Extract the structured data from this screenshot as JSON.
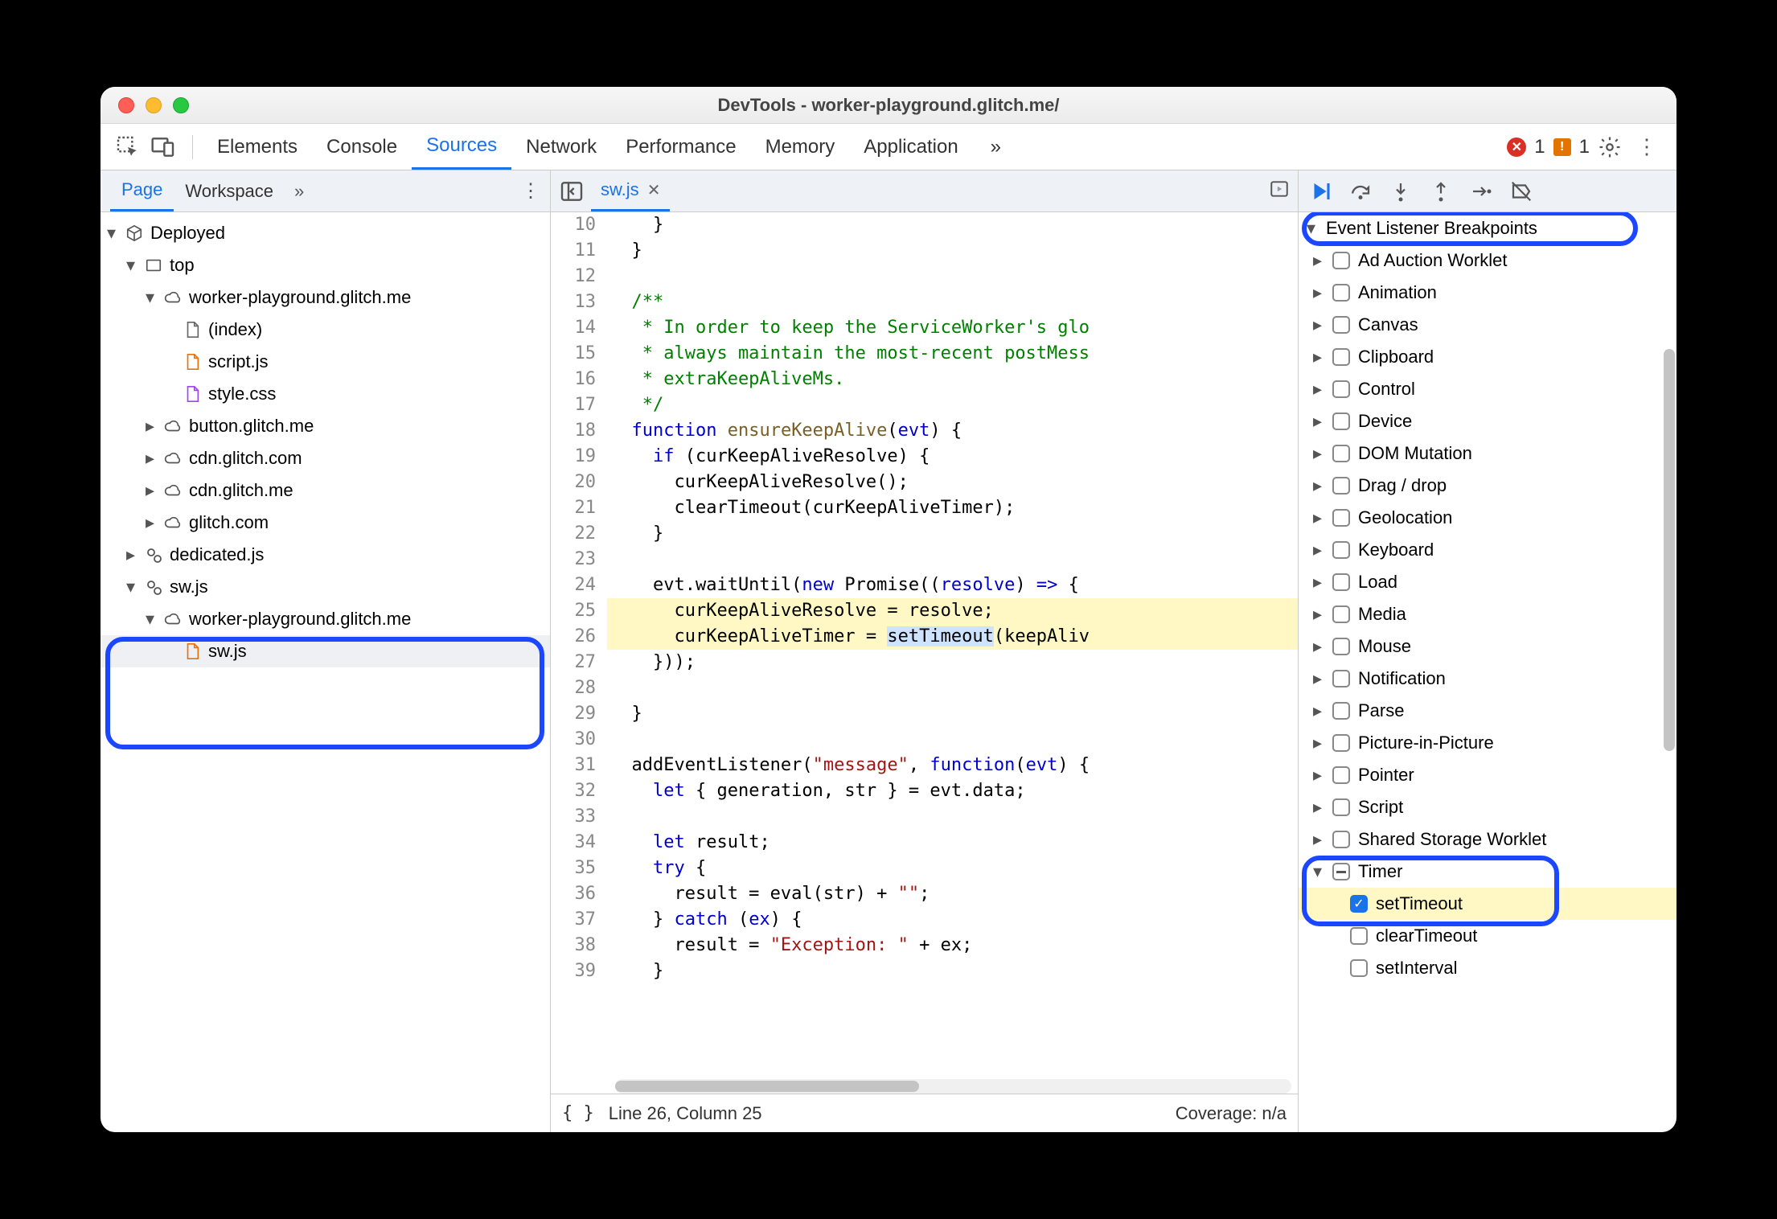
{
  "window": {
    "title": "DevTools - worker-playground.glitch.me/"
  },
  "toolbar": {
    "tabs": [
      "Elements",
      "Console",
      "Sources",
      "Network",
      "Performance",
      "Memory",
      "Application"
    ],
    "active": "Sources",
    "errors": "1",
    "warnings": "1"
  },
  "pageTabs": {
    "tabs": [
      "Page",
      "Workspace"
    ],
    "active": "Page",
    "more": "»"
  },
  "editorTab": {
    "name": "sw.js"
  },
  "tree": {
    "root": "Deployed",
    "top": "top",
    "origin1": "worker-playground.glitch.me",
    "files1": [
      "(index)",
      "script.js",
      "style.css"
    ],
    "clouds": [
      "button.glitch.me",
      "cdn.glitch.com",
      "cdn.glitch.me",
      "glitch.com"
    ],
    "dedicated": "dedicated.js",
    "sw": "sw.js",
    "swOrigin": "worker-playground.glitch.me",
    "swFile": "sw.js"
  },
  "code": {
    "startLine": 10,
    "lines": [
      {
        "n": 10,
        "segs": [
          {
            "t": "    }",
            "c": ""
          }
        ]
      },
      {
        "n": 11,
        "segs": [
          {
            "t": "  }",
            "c": ""
          }
        ]
      },
      {
        "n": 12,
        "segs": [
          {
            "t": "",
            "c": ""
          }
        ]
      },
      {
        "n": 13,
        "segs": [
          {
            "t": "  /**",
            "c": "k-comment"
          }
        ]
      },
      {
        "n": 14,
        "segs": [
          {
            "t": "   * In order to keep the ServiceWorker's glo",
            "c": "k-comment"
          }
        ]
      },
      {
        "n": 15,
        "segs": [
          {
            "t": "   * always maintain the most-recent postMess",
            "c": "k-comment"
          }
        ]
      },
      {
        "n": 16,
        "segs": [
          {
            "t": "   * extraKeepAliveMs.",
            "c": "k-comment"
          }
        ]
      },
      {
        "n": 17,
        "segs": [
          {
            "t": "   */",
            "c": "k-comment"
          }
        ]
      },
      {
        "n": 18,
        "segs": [
          {
            "t": "  ",
            "c": ""
          },
          {
            "t": "function",
            "c": "k-blue"
          },
          {
            "t": " ",
            "c": ""
          },
          {
            "t": "ensureKeepAlive",
            "c": "k-func"
          },
          {
            "t": "(",
            "c": ""
          },
          {
            "t": "evt",
            "c": "k-blue"
          },
          {
            "t": ") {",
            "c": ""
          }
        ]
      },
      {
        "n": 19,
        "segs": [
          {
            "t": "    ",
            "c": ""
          },
          {
            "t": "if",
            "c": "k-blue"
          },
          {
            "t": " (curKeepAliveResolve) {",
            "c": ""
          }
        ]
      },
      {
        "n": 20,
        "segs": [
          {
            "t": "      curKeepAliveResolve();",
            "c": ""
          }
        ]
      },
      {
        "n": 21,
        "segs": [
          {
            "t": "      clearTimeout(curKeepAliveTimer);",
            "c": ""
          }
        ]
      },
      {
        "n": 22,
        "segs": [
          {
            "t": "    }",
            "c": ""
          }
        ]
      },
      {
        "n": 23,
        "segs": [
          {
            "t": "",
            "c": ""
          }
        ]
      },
      {
        "n": 24,
        "segs": [
          {
            "t": "    evt.waitUntil(",
            "c": ""
          },
          {
            "t": "new",
            "c": "k-blue"
          },
          {
            "t": " Promise((",
            "c": ""
          },
          {
            "t": "resolve",
            "c": "k-blue"
          },
          {
            "t": ") ",
            "c": ""
          },
          {
            "t": "=>",
            "c": "k-blue"
          },
          {
            "t": " {",
            "c": ""
          }
        ]
      },
      {
        "n": 25,
        "segs": [
          {
            "t": "      curKeepAliveResolve = resolve;",
            "c": ""
          }
        ],
        "hl": true
      },
      {
        "n": 26,
        "segs": [
          {
            "t": "      curKeepAliveTimer = ",
            "c": ""
          },
          {
            "t": "setTimeout",
            "c": "",
            "sel": true
          },
          {
            "t": "(keepAliv",
            "c": ""
          }
        ],
        "hl": true
      },
      {
        "n": 27,
        "segs": [
          {
            "t": "    }));",
            "c": ""
          }
        ]
      },
      {
        "n": 28,
        "segs": [
          {
            "t": "",
            "c": ""
          }
        ]
      },
      {
        "n": 29,
        "segs": [
          {
            "t": "  }",
            "c": ""
          }
        ]
      },
      {
        "n": 30,
        "segs": [
          {
            "t": "",
            "c": ""
          }
        ]
      },
      {
        "n": 31,
        "segs": [
          {
            "t": "  addEventListener(",
            "c": ""
          },
          {
            "t": "\"message\"",
            "c": "k-str"
          },
          {
            "t": ", ",
            "c": ""
          },
          {
            "t": "function",
            "c": "k-blue"
          },
          {
            "t": "(",
            "c": ""
          },
          {
            "t": "evt",
            "c": "k-blue"
          },
          {
            "t": ") {",
            "c": ""
          }
        ]
      },
      {
        "n": 32,
        "segs": [
          {
            "t": "    ",
            "c": ""
          },
          {
            "t": "let",
            "c": "k-blue"
          },
          {
            "t": " { generation, str } = evt.data;",
            "c": ""
          }
        ]
      },
      {
        "n": 33,
        "segs": [
          {
            "t": "",
            "c": ""
          }
        ]
      },
      {
        "n": 34,
        "segs": [
          {
            "t": "    ",
            "c": ""
          },
          {
            "t": "let",
            "c": "k-blue"
          },
          {
            "t": " result;",
            "c": ""
          }
        ]
      },
      {
        "n": 35,
        "segs": [
          {
            "t": "    ",
            "c": ""
          },
          {
            "t": "try",
            "c": "k-blue"
          },
          {
            "t": " {",
            "c": ""
          }
        ]
      },
      {
        "n": 36,
        "segs": [
          {
            "t": "      result = eval(str) + ",
            "c": ""
          },
          {
            "t": "\"\"",
            "c": "k-str"
          },
          {
            "t": ";",
            "c": ""
          }
        ]
      },
      {
        "n": 37,
        "segs": [
          {
            "t": "    } ",
            "c": ""
          },
          {
            "t": "catch",
            "c": "k-blue"
          },
          {
            "t": " (",
            "c": ""
          },
          {
            "t": "ex",
            "c": "k-blue"
          },
          {
            "t": ") {",
            "c": ""
          }
        ]
      },
      {
        "n": 38,
        "segs": [
          {
            "t": "      result = ",
            "c": ""
          },
          {
            "t": "\"Exception: \"",
            "c": "k-str"
          },
          {
            "t": " + ex;",
            "c": ""
          }
        ]
      },
      {
        "n": 39,
        "segs": [
          {
            "t": "    }",
            "c": ""
          }
        ]
      }
    ]
  },
  "status": {
    "pos": "Line 26, Column 25",
    "coverage": "Coverage: n/a"
  },
  "breakpoints": {
    "header": "Event Listener Breakpoints",
    "categories": [
      "Ad Auction Worklet",
      "Animation",
      "Canvas",
      "Clipboard",
      "Control",
      "Device",
      "DOM Mutation",
      "Drag / drop",
      "Geolocation",
      "Keyboard",
      "Load",
      "Media",
      "Mouse",
      "Notification",
      "Parse",
      "Picture-in-Picture",
      "Pointer",
      "Script",
      "Shared Storage Worklet"
    ],
    "timer": {
      "label": "Timer",
      "items": [
        "setTimeout",
        "clearTimeout",
        "setInterval"
      ],
      "checked": "setTimeout"
    }
  }
}
